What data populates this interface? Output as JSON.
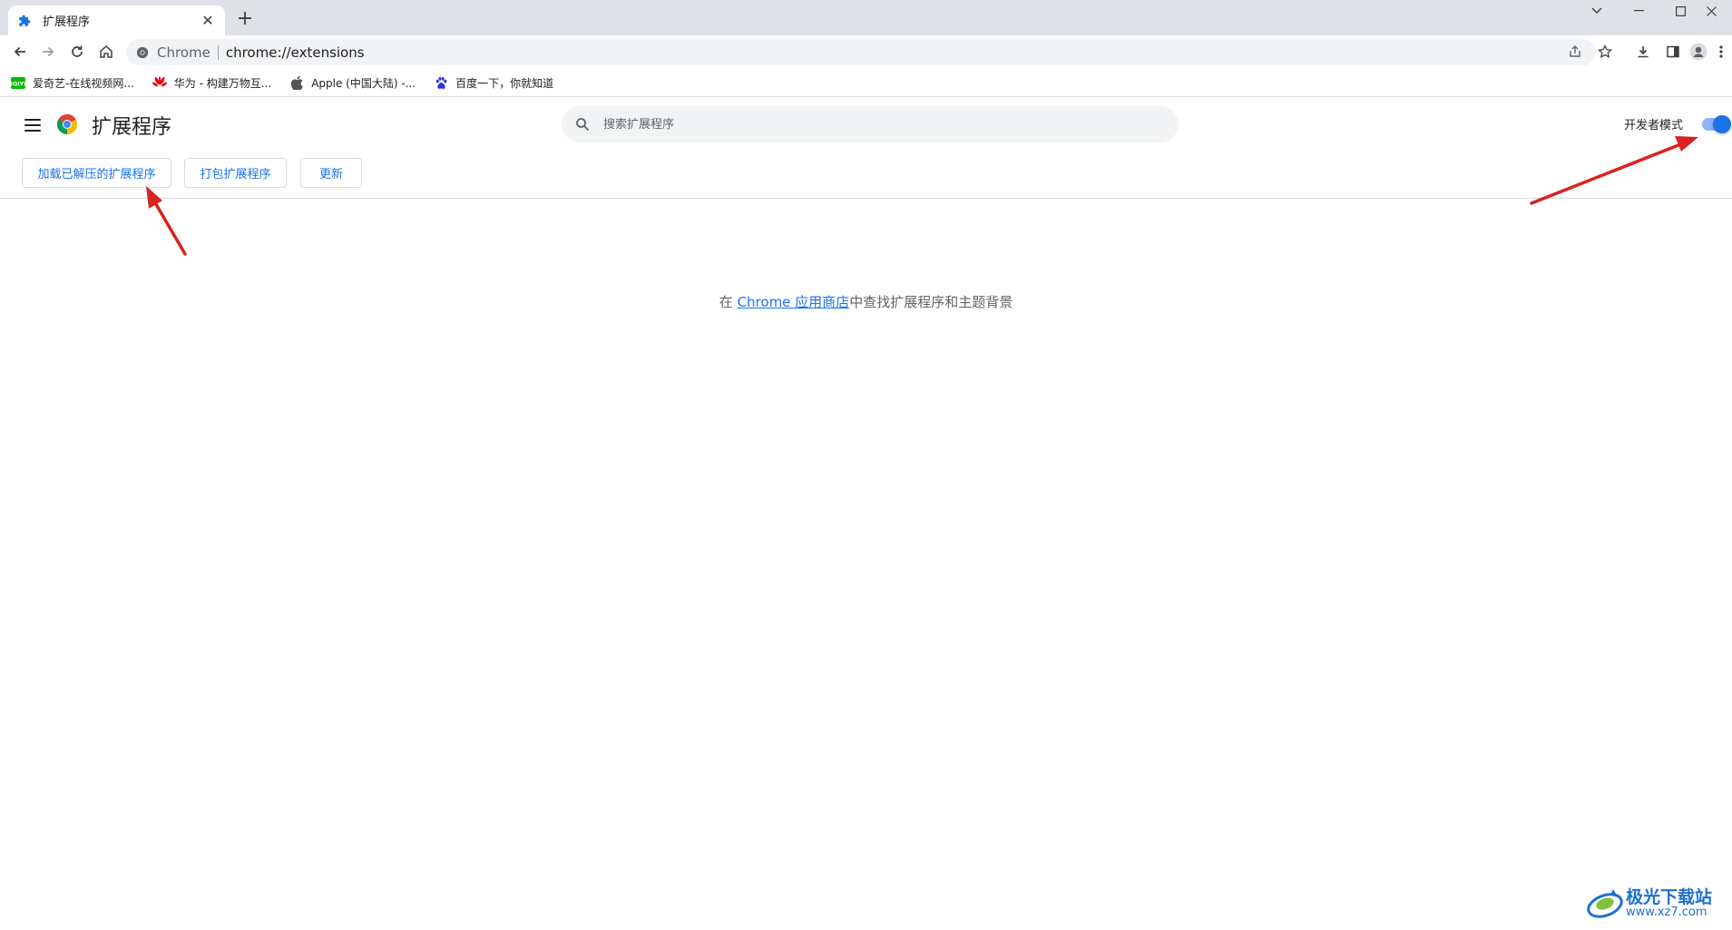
{
  "browser": {
    "tab": {
      "title": "扩展程序",
      "favicon": "puzzle-icon"
    },
    "new_tab_label": "+",
    "window_controls": [
      "chevron-down-icon",
      "minimize-icon",
      "maximize-icon",
      "close-icon"
    ],
    "omnibox": {
      "chip": "Chrome",
      "url": "chrome://extensions"
    },
    "bookmarks": [
      {
        "label": "爱奇艺-在线视频网...",
        "icon": "iqiyi-icon",
        "color": "#00be06"
      },
      {
        "label": "华为 - 构建万物互...",
        "icon": "huawei-icon",
        "color": "#e60012"
      },
      {
        "label": "Apple (中国大陆) -...",
        "icon": "apple-icon",
        "color": "#555555"
      },
      {
        "label": "百度一下，你就知道",
        "icon": "baidu-icon",
        "color": "#2932e1"
      }
    ]
  },
  "extensions_page": {
    "title": "扩展程序",
    "search_placeholder": "搜索扩展程序",
    "dev_mode_label": "开发者模式",
    "dev_mode_on": true,
    "buttons": {
      "load_unpacked": "加载已解压的扩展程序",
      "pack": "打包扩展程序",
      "update": "更新"
    },
    "empty_message": {
      "prefix": "在 ",
      "link": "Chrome 应用商店",
      "suffix": "中查找扩展程序和主题背景"
    }
  },
  "watermark": {
    "title": "极光下载站",
    "url": "www.xz7.com"
  },
  "colors": {
    "accent": "#1a73e8",
    "annotation_arrow": "#d9231f"
  }
}
